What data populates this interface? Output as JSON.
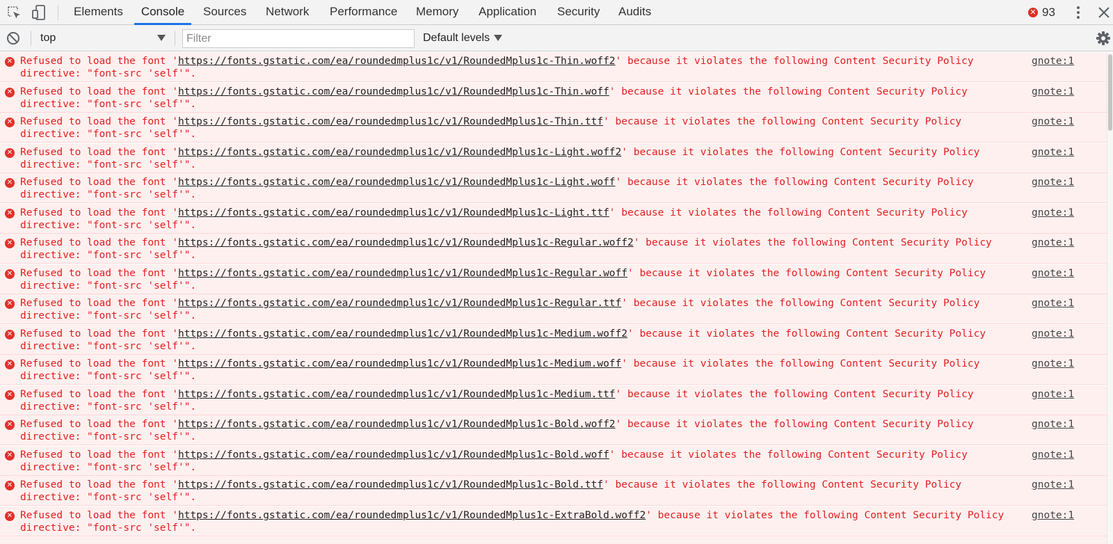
{
  "tabs": [
    {
      "label": "Elements",
      "active": false
    },
    {
      "label": "Console",
      "active": true
    },
    {
      "label": "Sources",
      "active": false
    },
    {
      "label": "Network",
      "active": false
    },
    {
      "label": "Performance",
      "active": false
    },
    {
      "label": "Memory",
      "active": false
    },
    {
      "label": "Application",
      "active": false
    },
    {
      "label": "Security",
      "active": false
    },
    {
      "label": "Audits",
      "active": false
    }
  ],
  "toolbar_icons": {
    "inspect": "inspect-element-icon",
    "device": "device-toolbar-icon",
    "more": "kebab-menu-icon",
    "close": "close-icon"
  },
  "error_count": "93",
  "console_toolbar": {
    "context": "top",
    "filter_placeholder": "Filter",
    "filter_value": "",
    "levels": "Default levels"
  },
  "colors": {
    "error_text": "#e02020",
    "error_bg": "#fff0f0",
    "error_icon": "#e0322a",
    "active_tab": "#1a73e8"
  },
  "messages": [
    {
      "prefix": "Refused to load the font '",
      "url": "https://fonts.gstatic.com/ea/roundedmplus1c/v1/RoundedMplus1c-Thin.woff2",
      "suffix": "' because it violates the following Content Security Policy directive: \"font-src 'self'\".",
      "source": "gnote:1"
    },
    {
      "prefix": "Refused to load the font '",
      "url": "https://fonts.gstatic.com/ea/roundedmplus1c/v1/RoundedMplus1c-Thin.woff",
      "suffix": "' because it violates the following Content Security Policy directive: \"font-src 'self'\".",
      "source": "gnote:1"
    },
    {
      "prefix": "Refused to load the font '",
      "url": "https://fonts.gstatic.com/ea/roundedmplus1c/v1/RoundedMplus1c-Thin.ttf",
      "suffix": "' because it violates the following Content Security Policy directive: \"font-src 'self'\".",
      "source": "gnote:1"
    },
    {
      "prefix": "Refused to load the font '",
      "url": "https://fonts.gstatic.com/ea/roundedmplus1c/v1/RoundedMplus1c-Light.woff2",
      "suffix": "' because it violates the following Content Security Policy directive: \"font-src 'self'\".",
      "source": "gnote:1"
    },
    {
      "prefix": "Refused to load the font '",
      "url": "https://fonts.gstatic.com/ea/roundedmplus1c/v1/RoundedMplus1c-Light.woff",
      "suffix": "' because it violates the following Content Security Policy directive: \"font-src 'self'\".",
      "source": "gnote:1"
    },
    {
      "prefix": "Refused to load the font '",
      "url": "https://fonts.gstatic.com/ea/roundedmplus1c/v1/RoundedMplus1c-Light.ttf",
      "suffix": "' because it violates the following Content Security Policy directive: \"font-src 'self'\".",
      "source": "gnote:1"
    },
    {
      "prefix": "Refused to load the font '",
      "url": "https://fonts.gstatic.com/ea/roundedmplus1c/v1/RoundedMplus1c-Regular.woff2",
      "suffix": "' because it violates the following Content Security Policy directive: \"font-src 'self'\".",
      "source": "gnote:1"
    },
    {
      "prefix": "Refused to load the font '",
      "url": "https://fonts.gstatic.com/ea/roundedmplus1c/v1/RoundedMplus1c-Regular.woff",
      "suffix": "' because it violates the following Content Security Policy directive: \"font-src 'self'\".",
      "source": "gnote:1"
    },
    {
      "prefix": "Refused to load the font '",
      "url": "https://fonts.gstatic.com/ea/roundedmplus1c/v1/RoundedMplus1c-Regular.ttf",
      "suffix": "' because it violates the following Content Security Policy directive: \"font-src 'self'\".",
      "source": "gnote:1"
    },
    {
      "prefix": "Refused to load the font '",
      "url": "https://fonts.gstatic.com/ea/roundedmplus1c/v1/RoundedMplus1c-Medium.woff2",
      "suffix": "' because it violates the following Content Security Policy directive: \"font-src 'self'\".",
      "source": "gnote:1"
    },
    {
      "prefix": "Refused to load the font '",
      "url": "https://fonts.gstatic.com/ea/roundedmplus1c/v1/RoundedMplus1c-Medium.woff",
      "suffix": "' because it violates the following Content Security Policy directive: \"font-src 'self'\".",
      "source": "gnote:1"
    },
    {
      "prefix": "Refused to load the font '",
      "url": "https://fonts.gstatic.com/ea/roundedmplus1c/v1/RoundedMplus1c-Medium.ttf",
      "suffix": "' because it violates the following Content Security Policy directive: \"font-src 'self'\".",
      "source": "gnote:1"
    },
    {
      "prefix": "Refused to load the font '",
      "url": "https://fonts.gstatic.com/ea/roundedmplus1c/v1/RoundedMplus1c-Bold.woff2",
      "suffix": "' because it violates the following Content Security Policy directive: \"font-src 'self'\".",
      "source": "gnote:1"
    },
    {
      "prefix": "Refused to load the font '",
      "url": "https://fonts.gstatic.com/ea/roundedmplus1c/v1/RoundedMplus1c-Bold.woff",
      "suffix": "' because it violates the following Content Security Policy directive: \"font-src 'self'\".",
      "source": "gnote:1"
    },
    {
      "prefix": "Refused to load the font '",
      "url": "https://fonts.gstatic.com/ea/roundedmplus1c/v1/RoundedMplus1c-Bold.ttf",
      "suffix": "' because it violates the following Content Security Policy directive: \"font-src 'self'\".",
      "source": "gnote:1"
    },
    {
      "prefix": "Refused to load the font '",
      "url": "https://fonts.gstatic.com/ea/roundedmplus1c/v1/RoundedMplus1c-ExtraBold.woff2",
      "suffix": "' because it violates the following Content Security Policy directive: \"font-src 'self'\".",
      "source": "gnote:1"
    }
  ]
}
